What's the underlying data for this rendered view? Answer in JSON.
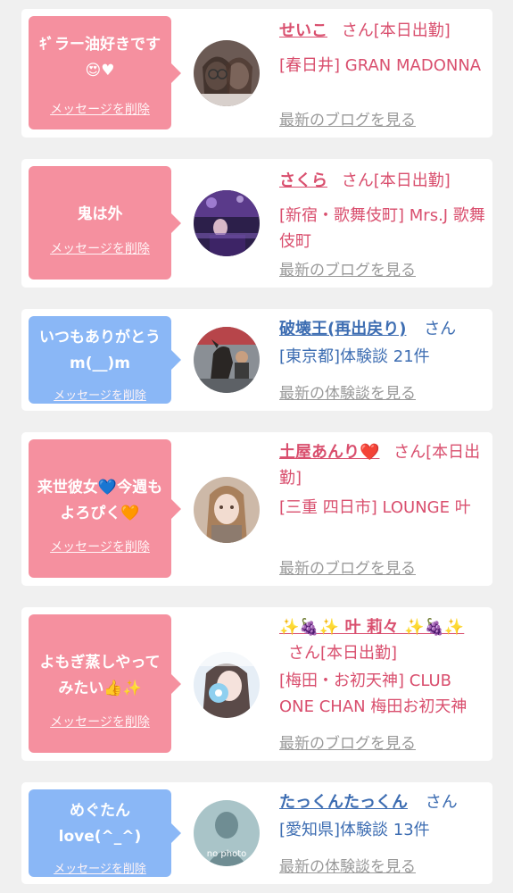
{
  "colors": {
    "pink_bubble": "#f5909f",
    "blue_bubble": "#8ab7f6",
    "pink_text": "#d94f6e",
    "blue_text": "#3d6db2",
    "link_gray": "#999999",
    "background": "#f0f0f0"
  },
  "cards": [
    {
      "message": "ｷﾞラー油好きです😍♥",
      "delete_label": "メッセージを削除",
      "name": "せいこ",
      "suffix": "さん[本日出勤]",
      "place": "[春日井] GRAN MADONNA",
      "link": "最新のブログを見る"
    },
    {
      "message": "鬼は外",
      "delete_label": "メッセージを削除",
      "name": "さくら",
      "suffix": "さん[本日出勤]",
      "place": "[新宿・歌舞伎町] Mrs.J 歌舞伎町",
      "link": "最新のブログを見る"
    },
    {
      "message": "いつもありがとう m(__)m",
      "delete_label": "メッセージを削除",
      "name": "破壊王(再出戻り)",
      "suffix": "さん",
      "place": "[東京都]体験談 21件",
      "link": "最新の体験談を見る"
    },
    {
      "message": "来世彼女💙今週もよろぴく🧡",
      "delete_label": "メッセージを削除",
      "name": "土屋あんり❤️",
      "suffix": "さん[本日出勤]",
      "place": "[三重 四日市] LOUNGE 叶",
      "link": "最新のブログを見る"
    },
    {
      "message": "よもぎ蒸しやってみたい👍✨",
      "delete_label": "メッセージを削除",
      "name": "✨🍇✨ 叶 莉々 ✨🍇✨",
      "suffix": "さん[本日出勤]",
      "place": "[梅田・お初天神] CLUB ONE CHAN 梅田お初天神",
      "link": "最新のブログを見る"
    },
    {
      "message": "めぐたん love(^_^)",
      "delete_label": "メッセージを削除",
      "name": "たっくんたっくん",
      "suffix": "さん",
      "place": "[愛知県]体験談 13件",
      "link": "最新の体験談を見る",
      "avatar_text": "no photo"
    }
  ]
}
